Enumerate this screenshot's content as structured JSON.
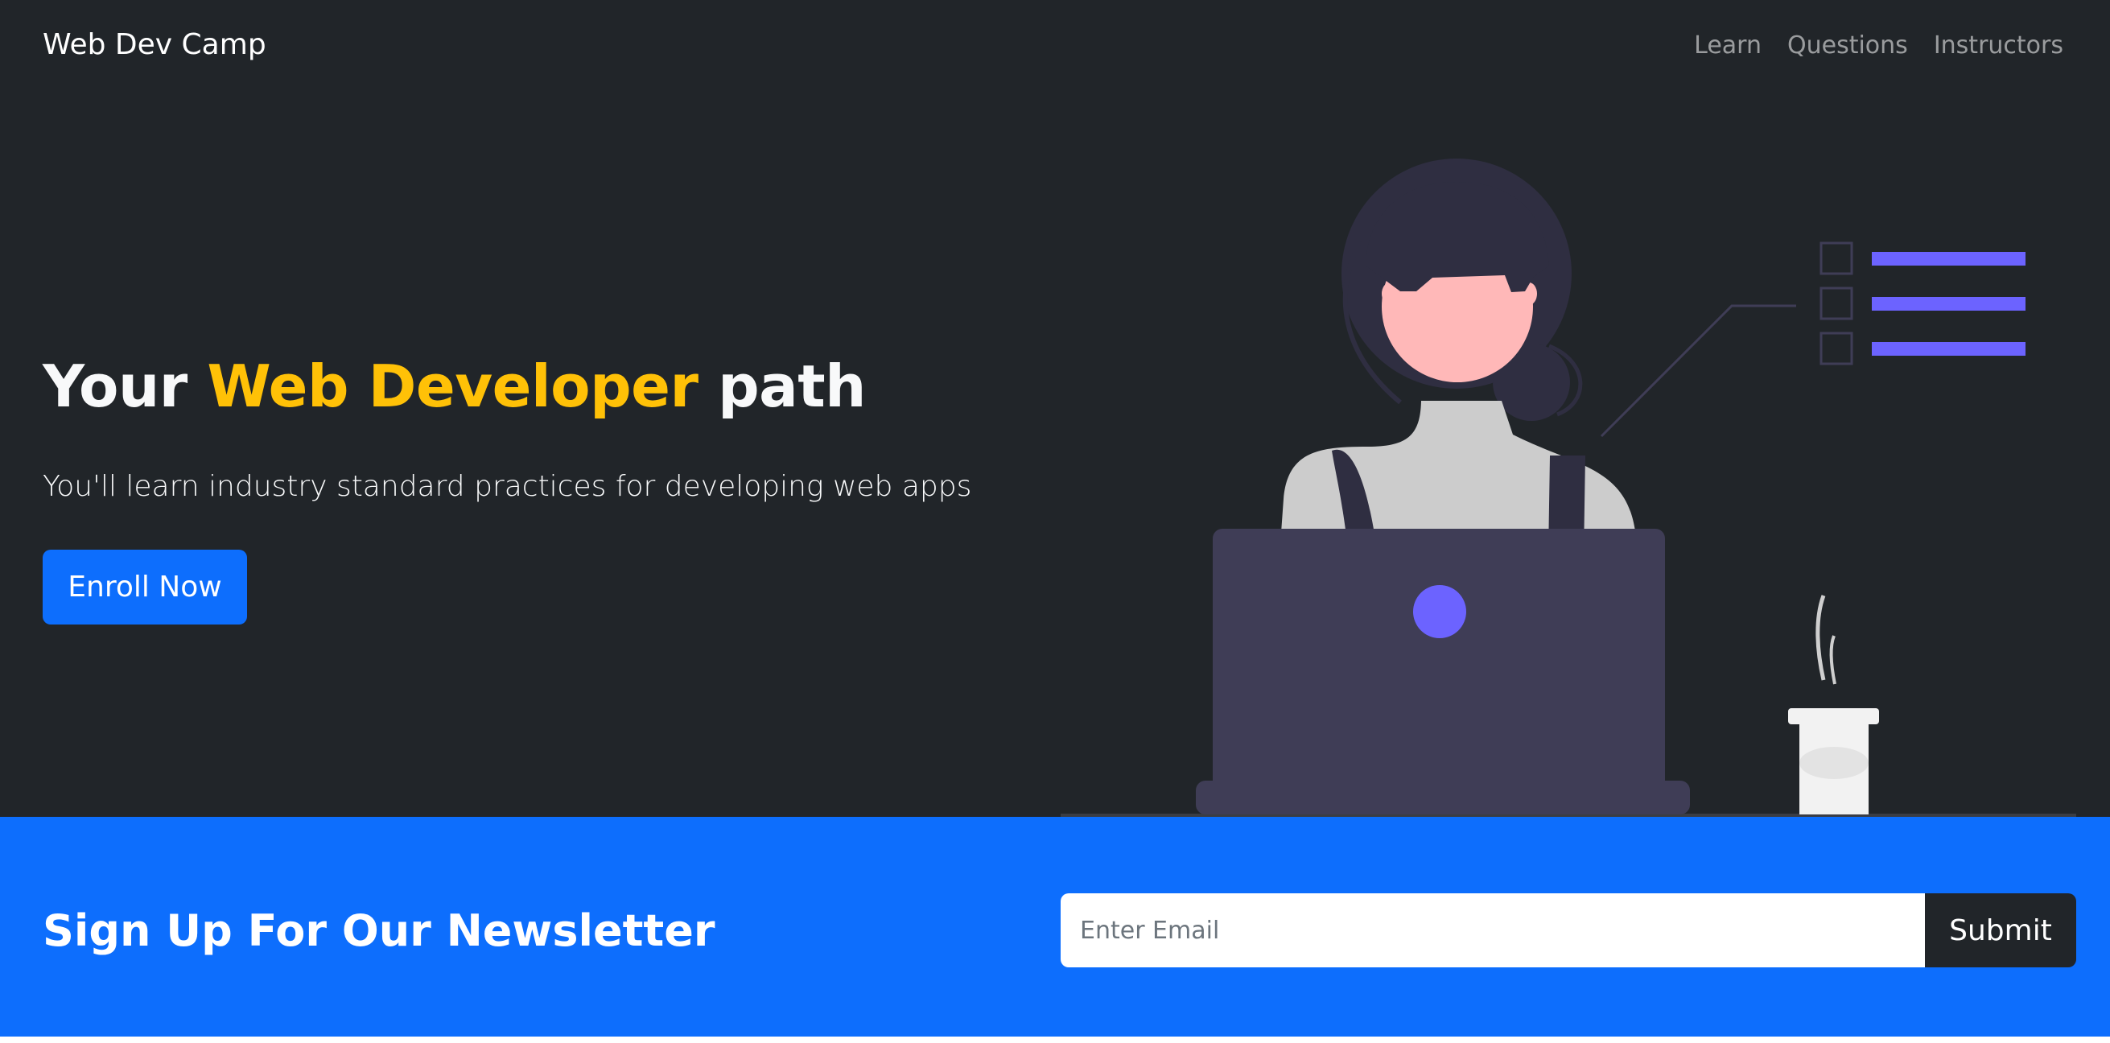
{
  "navbar": {
    "brand": "Web Dev Camp",
    "links": [
      "Learn",
      "Questions",
      "Instructors"
    ]
  },
  "hero": {
    "headline_prefix": "Your ",
    "headline_accent": "Web Developer",
    "headline_suffix": " path",
    "lead": "You'll learn industry standard practices for developing web apps",
    "cta_label": "Enroll Now"
  },
  "newsletter": {
    "title": "Sign Up For Our Newsletter",
    "email_placeholder": "Enter Email",
    "submit_label": "Submit"
  },
  "colors": {
    "hero_bg": "#212529",
    "accent_yellow": "#ffc107",
    "primary_blue": "#0d6efd",
    "illustration_purple": "#6c63ff",
    "laptop": "#3f3d56"
  },
  "icons": {
    "illustration": "woman-at-laptop-illustration",
    "checklist": "checklist-icon",
    "cup": "coffee-cup-icon"
  }
}
